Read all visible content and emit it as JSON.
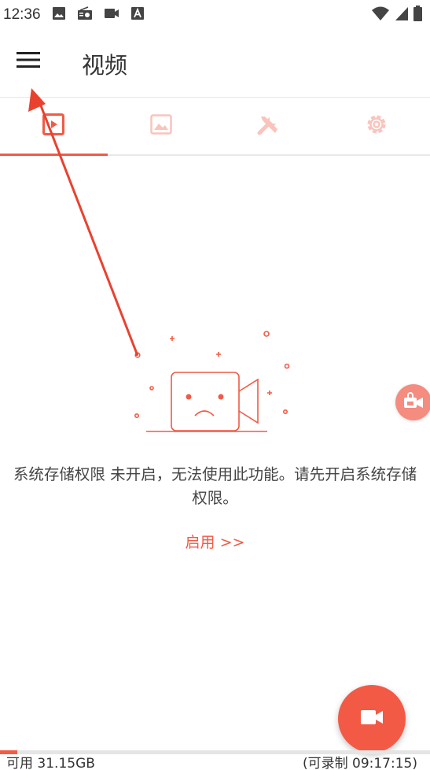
{
  "status": {
    "time": "12:36",
    "icons": [
      "image-icon",
      "radio-icon",
      "video-icon",
      "font-icon"
    ],
    "right_icons": [
      "wifi-icon",
      "signal-icon",
      "battery-icon"
    ]
  },
  "header": {
    "title": "视频",
    "menu_icon": "hamburger-icon"
  },
  "tabs": [
    {
      "icon": "video-square-icon",
      "active": true
    },
    {
      "icon": "image-icon",
      "active": false
    },
    {
      "icon": "tools-icon",
      "active": false
    },
    {
      "icon": "gear-icon",
      "active": false
    }
  ],
  "empty_state": {
    "message": "系统存储权限 未开启，无法使用此功能。请先开启系统存储权限。",
    "link": "启用 >>"
  },
  "storage": {
    "available": "可用 31.15GB",
    "record_time": "(可录制 09:17:15)",
    "used_fraction": 0.04
  },
  "colors": {
    "accent": "#f25a45",
    "accent_light": "#f9c4bc",
    "float_button": "#f48c80",
    "annotation_arrow": "#e8422f"
  }
}
